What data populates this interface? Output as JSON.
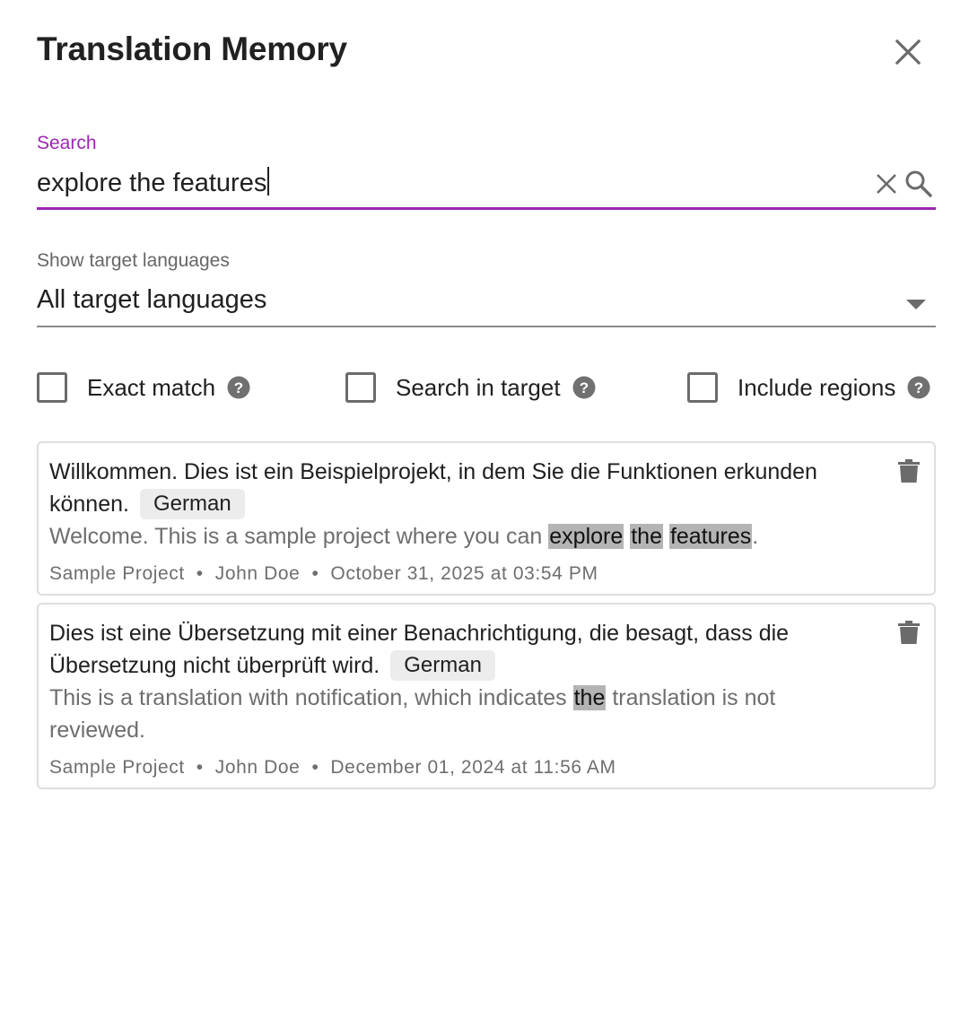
{
  "dialog": {
    "title": "Translation Memory"
  },
  "search": {
    "label": "Search",
    "value": "explore the features"
  },
  "target_languages": {
    "label": "Show target languages",
    "selected": "All target languages"
  },
  "options": [
    {
      "label": "Exact match",
      "checked": false
    },
    {
      "label": "Search in target",
      "checked": false
    },
    {
      "label": "Include regions",
      "checked": false
    }
  ],
  "results": [
    {
      "source": "Willkommen. Dies ist ein Beispielprojekt, in dem Sie die Funktionen erkunden können.",
      "language": "German",
      "target_parts": [
        "Welcome. This is a sample project where you can ",
        "explore",
        " ",
        "the",
        " ",
        "features",
        "."
      ],
      "project": "Sample Project",
      "author": "John Doe",
      "date": "October 31, 2025 at 03:54 PM"
    },
    {
      "source": "Dies ist eine Übersetzung mit einer Benachrichtigung, die besagt, dass die Übersetzung nicht überprüft wird.",
      "language": "German",
      "target_parts": [
        "This is a translation with notification, which indicates ",
        "the",
        " translation is not reviewed."
      ],
      "project": "Sample Project",
      "author": "John Doe",
      "date": "December 01, 2024 at 11:56 AM"
    }
  ],
  "meta_separator": "•",
  "colors": {
    "accent": "#9c27b0",
    "highlight": "#b4b4b4",
    "icon": "#6b6b6b"
  },
  "icons": {
    "close": "close-icon",
    "clear": "clear-icon",
    "search": "search-icon",
    "dropdown": "caret-down-icon",
    "help": "help-icon",
    "delete": "delete-icon"
  }
}
